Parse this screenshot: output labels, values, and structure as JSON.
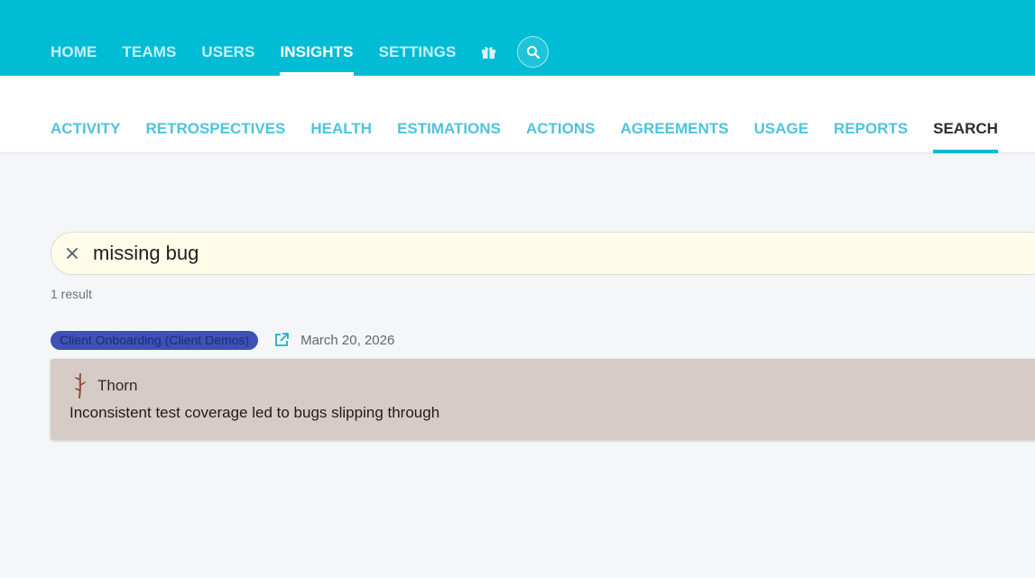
{
  "topnav": {
    "items": [
      {
        "label": "HOME"
      },
      {
        "label": "TEAMS"
      },
      {
        "label": "USERS"
      },
      {
        "label": "INSIGHTS",
        "active": true
      },
      {
        "label": "SETTINGS"
      }
    ],
    "icons": [
      "gift-icon",
      "search-icon"
    ]
  },
  "subnav": {
    "items": [
      {
        "label": "ACTIVITY"
      },
      {
        "label": "RETROSPECTIVES"
      },
      {
        "label": "HEALTH"
      },
      {
        "label": "ESTIMATIONS"
      },
      {
        "label": "ACTIONS"
      },
      {
        "label": "AGREEMENTS"
      },
      {
        "label": "USAGE"
      },
      {
        "label": "REPORTS"
      },
      {
        "label": "SEARCH",
        "active": true
      }
    ]
  },
  "search": {
    "value": "missing bug",
    "clear_icon": "close-icon"
  },
  "results": {
    "count_text": "1 result",
    "items": [
      {
        "team_tag": "Client Onboarding (Client Demos)",
        "link_icon": "open-in-new-icon",
        "date": "March 20, 2026",
        "category_icon": "thorn-icon",
        "category": "Thorn",
        "text": "Inconsistent test coverage led to bugs slipping through"
      }
    ]
  },
  "colors": {
    "primary": "#00bcd4",
    "tag_bg": "#3f51b5",
    "card_bg": "#d7cbc7",
    "search_bg": "#fffde9"
  }
}
